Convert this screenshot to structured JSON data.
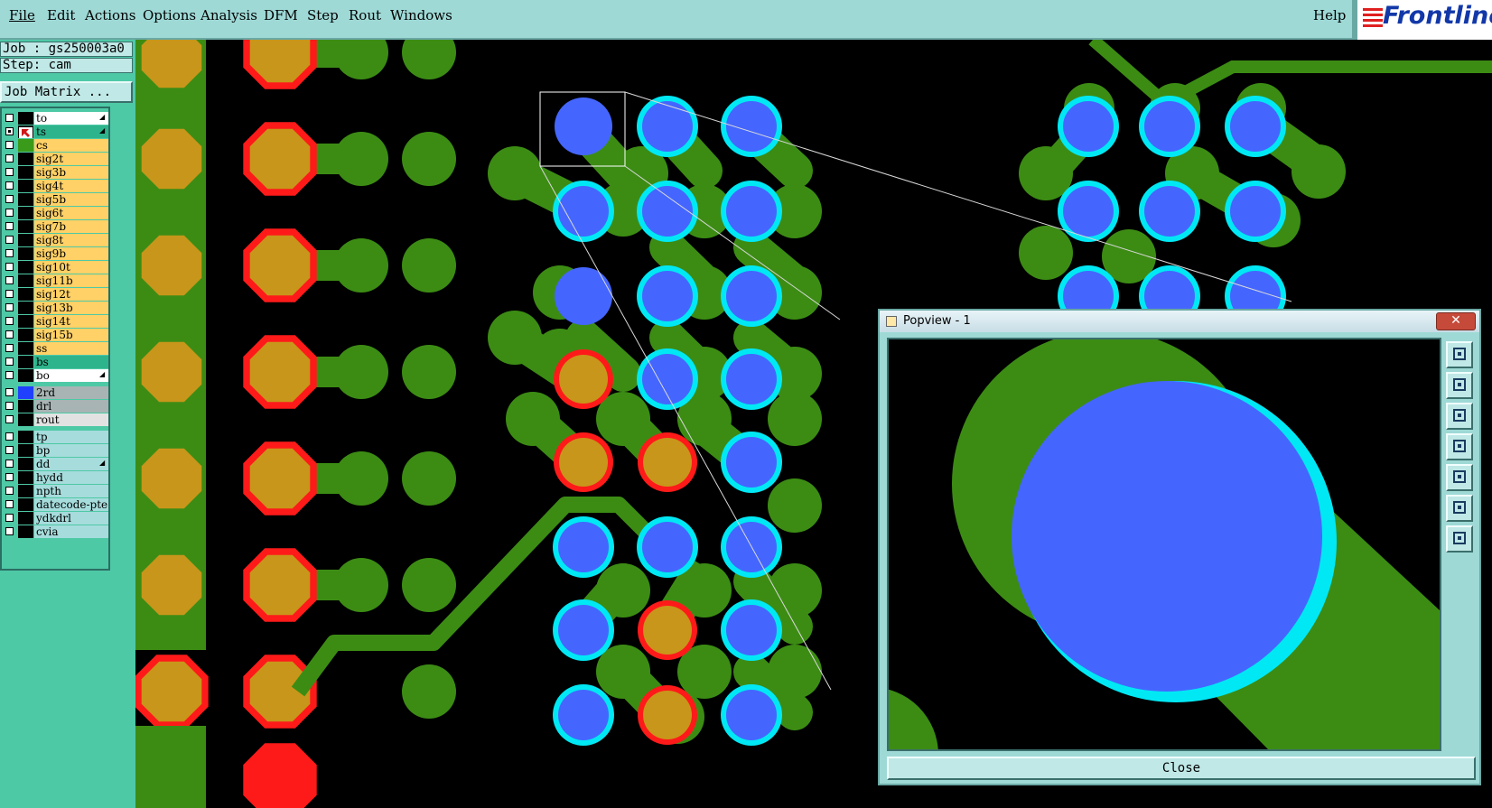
{
  "menu": {
    "items": [
      "File",
      "Edit",
      "Actions",
      "Options",
      "Analysis",
      "DFM",
      "Step",
      "Rout",
      "Windows"
    ],
    "help": "Help"
  },
  "brand": "Frontline",
  "job": {
    "job_label": "Job : gs250003a0",
    "step_label": "Step: cam",
    "matrix_button": "Job Matrix ..."
  },
  "layers": [
    {
      "name": "to",
      "color": "#ffffff",
      "checked": false,
      "swatch": "#000000",
      "tick": true
    },
    {
      "name": "ts",
      "color": "#2eb48c",
      "checked": true,
      "swatch": "#000000",
      "cursor": true,
      "tick": true
    },
    {
      "name": "cs",
      "color": "#ffd166",
      "checked": false,
      "swatch": "#3a9a1a"
    },
    {
      "name": "sig2t",
      "color": "#ffd166",
      "checked": false,
      "swatch": "#000000"
    },
    {
      "name": "sig3b",
      "color": "#ffd166",
      "checked": false,
      "swatch": "#000000"
    },
    {
      "name": "sig4t",
      "color": "#ffd166",
      "checked": false,
      "swatch": "#000000"
    },
    {
      "name": "sig5b",
      "color": "#ffd166",
      "checked": false,
      "swatch": "#000000"
    },
    {
      "name": "sig6t",
      "color": "#ffd166",
      "checked": false,
      "swatch": "#000000"
    },
    {
      "name": "sig7b",
      "color": "#ffd166",
      "checked": false,
      "swatch": "#000000"
    },
    {
      "name": "sig8t",
      "color": "#ffd166",
      "checked": false,
      "swatch": "#000000"
    },
    {
      "name": "sig9b",
      "color": "#ffd166",
      "checked": false,
      "swatch": "#000000"
    },
    {
      "name": "sig10t",
      "color": "#ffd166",
      "checked": false,
      "swatch": "#000000"
    },
    {
      "name": "sig11b",
      "color": "#ffd166",
      "checked": false,
      "swatch": "#000000"
    },
    {
      "name": "sig12t",
      "color": "#ffd166",
      "checked": false,
      "swatch": "#000000"
    },
    {
      "name": "sig13b",
      "color": "#ffd166",
      "checked": false,
      "swatch": "#000000"
    },
    {
      "name": "sig14t",
      "color": "#ffd166",
      "checked": false,
      "swatch": "#000000"
    },
    {
      "name": "sig15b",
      "color": "#ffd166",
      "checked": false,
      "swatch": "#000000"
    },
    {
      "name": "ss",
      "color": "#ffd166",
      "checked": false,
      "swatch": "#000000"
    },
    {
      "name": "bs",
      "color": "#2eb48c",
      "checked": false,
      "swatch": "#000000"
    },
    {
      "name": "bo",
      "color": "#ffffff",
      "checked": false,
      "swatch": "#000000",
      "tick": true
    },
    {
      "name": "2rd",
      "color": "#a8b4b4",
      "checked": false,
      "swatch": "#2040ff",
      "gap": true
    },
    {
      "name": "drl",
      "color": "#a8b4b4",
      "checked": false,
      "swatch": "#000000"
    },
    {
      "name": "rout",
      "color": "#e2e2e2",
      "checked": false,
      "swatch": "#000000"
    },
    {
      "name": "tp",
      "color": "#a6dcdc",
      "checked": false,
      "swatch": "#000000",
      "gap": true
    },
    {
      "name": "bp",
      "color": "#a6dcdc",
      "checked": false,
      "swatch": "#000000"
    },
    {
      "name": "dd",
      "color": "#a6dcdc",
      "checked": false,
      "swatch": "#000000",
      "tick": true
    },
    {
      "name": "hydd",
      "color": "#a6dcdc",
      "checked": false,
      "swatch": "#000000"
    },
    {
      "name": "npth",
      "color": "#a6dcdc",
      "checked": false,
      "swatch": "#000000"
    },
    {
      "name": "datecode-pte",
      "color": "#a6dcdc",
      "checked": false,
      "swatch": "#000000"
    },
    {
      "name": "ydkdrl",
      "color": "#a6dcdc",
      "checked": false,
      "swatch": "#000000"
    },
    {
      "name": "cvia",
      "color": "#a6dcdc",
      "checked": false,
      "swatch": "#000000"
    }
  ],
  "popview": {
    "title": "Popview - 1",
    "close_x": "✕",
    "close_button": "Close",
    "tools": [
      "zoom-in-icon",
      "pan-up-icon",
      "pan-down-icon",
      "pan-left-icon",
      "pan-right-icon",
      "fit-view-icon",
      "center-view-icon"
    ]
  },
  "colors": {
    "trace": "#3c8c14",
    "pad_blue": "#4466ff",
    "pad_cyan": "#00e8f4",
    "pad_gold": "#c8961a",
    "pad_red": "#ff1a1a"
  }
}
